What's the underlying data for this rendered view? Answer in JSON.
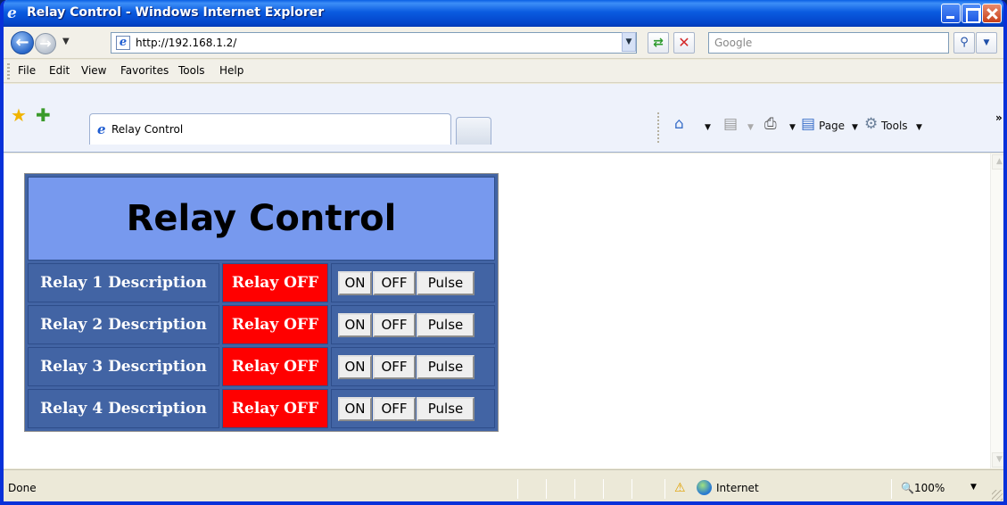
{
  "window": {
    "title": "Relay Control - Windows Internet Explorer"
  },
  "address_bar": {
    "url": "http://192.168.1.2/",
    "search_placeholder": "Google"
  },
  "menu": [
    "File",
    "Edit",
    "View",
    "Favorites",
    "Tools",
    "Help"
  ],
  "tab": {
    "label": "Relay Control"
  },
  "command_bar": {
    "page_label": "Page",
    "tools_label": "Tools"
  },
  "page": {
    "heading": "Relay Control",
    "relays": [
      {
        "description": "Relay 1 Description",
        "state": "Relay OFF"
      },
      {
        "description": "Relay 2 Description",
        "state": "Relay OFF"
      },
      {
        "description": "Relay 3 Description",
        "state": "Relay OFF"
      },
      {
        "description": "Relay 4 Description",
        "state": "Relay OFF"
      }
    ],
    "buttons": {
      "on": "ON",
      "off": "OFF",
      "pulse": "Pulse"
    }
  },
  "status_bar": {
    "text": "Done",
    "zone": "Internet",
    "zoom": "100%"
  },
  "colors": {
    "relay_off_bg": "#ff0000",
    "table_bg": "#4264a4",
    "header_bg": "#7799ee"
  }
}
